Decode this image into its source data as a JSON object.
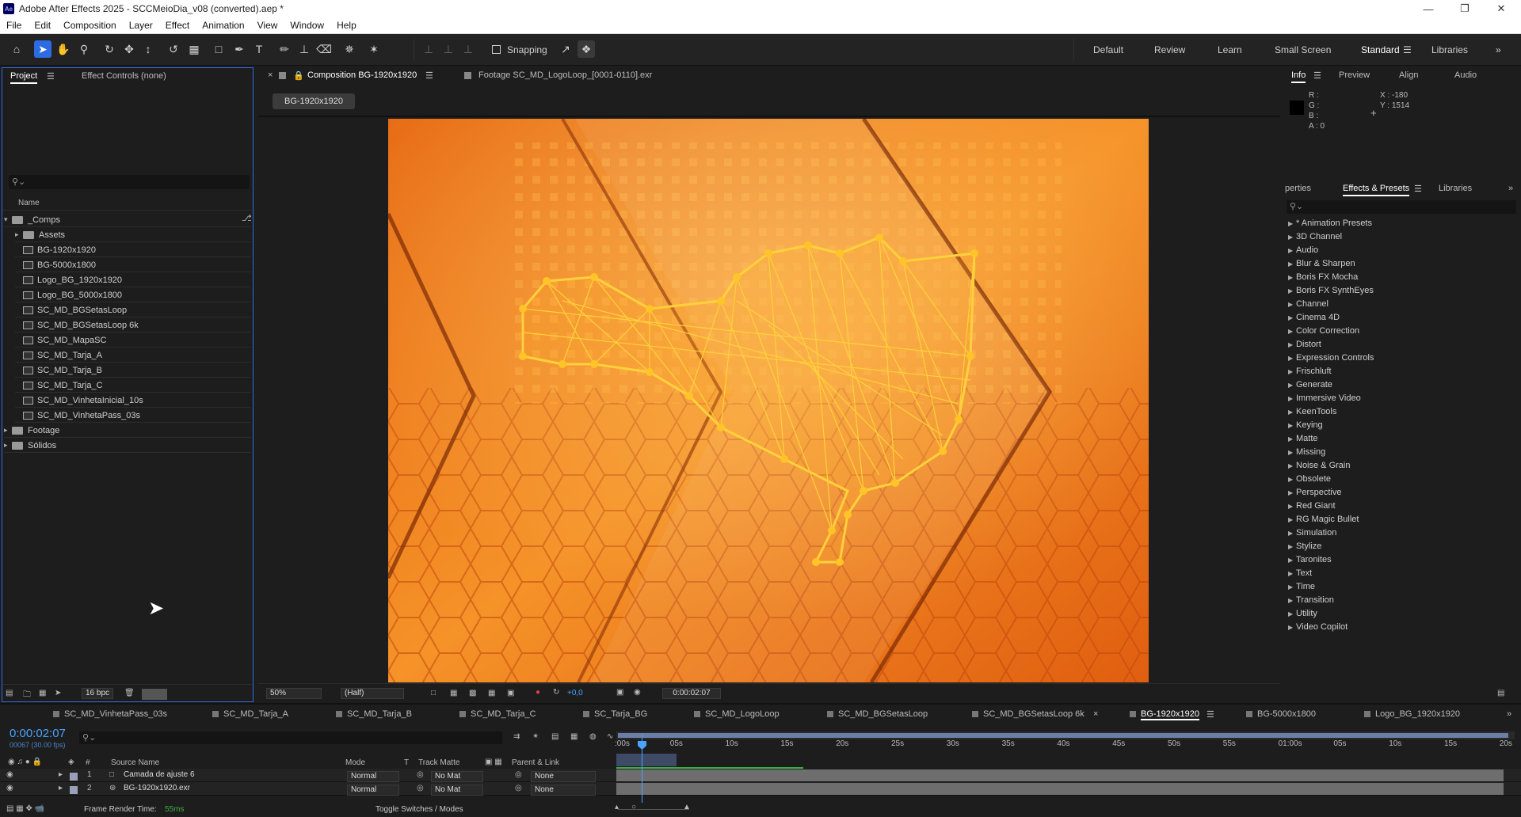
{
  "app": {
    "title": "Adobe After Effects 2025 - SCCMeioDia_v08 (converted).aep *",
    "icon_text": "Ae"
  },
  "menu": [
    "File",
    "Edit",
    "Composition",
    "Layer",
    "Effect",
    "Animation",
    "View",
    "Window",
    "Help"
  ],
  "toolbar": {
    "snapping_label": "Snapping",
    "workspaces": [
      "Default",
      "Review",
      "Learn",
      "Small Screen",
      "Standard",
      "Libraries"
    ],
    "active_workspace": "Standard"
  },
  "project": {
    "tab_project": "Project",
    "tab_effect_controls": "Effect Controls (none)",
    "search_placeholder": "",
    "column_name": "Name",
    "items": [
      {
        "type": "folder",
        "label": "_Comps",
        "depth": 0,
        "open": true
      },
      {
        "type": "folder",
        "label": "Assets",
        "depth": 1,
        "open": false
      },
      {
        "type": "comp",
        "label": "BG-1920x1920",
        "depth": 1
      },
      {
        "type": "comp",
        "label": "BG-5000x1800",
        "depth": 1
      },
      {
        "type": "comp",
        "label": "Logo_BG_1920x1920",
        "depth": 1
      },
      {
        "type": "comp",
        "label": "Logo_BG_5000x1800",
        "depth": 1
      },
      {
        "type": "comp",
        "label": "SC_MD_BGSetasLoop",
        "depth": 1
      },
      {
        "type": "comp",
        "label": "SC_MD_BGSetasLoop 6k",
        "depth": 1
      },
      {
        "type": "comp",
        "label": "SC_MD_MapaSC",
        "depth": 1
      },
      {
        "type": "comp",
        "label": "SC_MD_Tarja_A",
        "depth": 1
      },
      {
        "type": "comp",
        "label": "SC_MD_Tarja_B",
        "depth": 1
      },
      {
        "type": "comp",
        "label": "SC_MD_Tarja_C",
        "depth": 1
      },
      {
        "type": "comp",
        "label": "SC_MD_VinhetaInicial_10s",
        "depth": 1
      },
      {
        "type": "comp",
        "label": "SC_MD_VinhetaPass_03s",
        "depth": 1
      },
      {
        "type": "folder",
        "label": "Footage",
        "depth": 0,
        "open": false
      },
      {
        "type": "folder",
        "label": "Sólidos",
        "depth": 0,
        "open": false
      }
    ],
    "bpc": "16 bpc"
  },
  "viewer": {
    "tab_comp": "Composition BG-1920x1920",
    "tab_footage": "Footage SC_MD_LogoLoop_[0001-0110].exr",
    "breadcrumb": "BG-1920x1920",
    "zoom": "50%",
    "resolution": "(Half)",
    "exposure": "+0,0",
    "timecode": "0:00:02:07"
  },
  "info": {
    "tabs": [
      "Info",
      "Preview",
      "Align",
      "Audio"
    ],
    "r": "R :",
    "g": "G :",
    "b": "B :",
    "a": "A : 0",
    "x": "X : -180",
    "y": "Y : 1514"
  },
  "effects": {
    "tabs": [
      "perties",
      "Effects & Presets",
      "Libraries"
    ],
    "items": [
      "* Animation Presets",
      "3D Channel",
      "Audio",
      "Blur & Sharpen",
      "Boris FX Mocha",
      "Boris FX SynthEyes",
      "Channel",
      "Cinema 4D",
      "Color Correction",
      "Distort",
      "Expression Controls",
      "Frischluft",
      "Generate",
      "Immersive Video",
      "KeenTools",
      "Keying",
      "Matte",
      "Missing",
      "Noise & Grain",
      "Obsolete",
      "Perspective",
      "Red Giant",
      "RG Magic Bullet",
      "Simulation",
      "Stylize",
      "Taronites",
      "Text",
      "Time",
      "Transition",
      "Utility",
      "Video Copilot"
    ]
  },
  "timeline": {
    "tabs": [
      "SC_MD_VinhetaPass_03s",
      "SC_MD_Tarja_A",
      "SC_MD_Tarja_B",
      "SC_MD_Tarja_C",
      "SC_Tarja_BG",
      "SC_MD_LogoLoop",
      "SC_MD_BGSetasLoop",
      "SC_MD_BGSetasLoop 6k",
      "BG-1920x1920",
      "BG-5000x1800",
      "Logo_BG_1920x1920"
    ],
    "active_tab": "BG-1920x1920",
    "timecode": "0:00:02:07",
    "frame_info": "00067 (30.00 fps)",
    "columns": {
      "hash": "#",
      "source": "Source Name",
      "mode": "Mode",
      "t": "T",
      "track_matte": "Track Matte",
      "parent": "Parent & Link"
    },
    "ruler": [
      ":00s",
      "05s",
      "10s",
      "15s",
      "20s",
      "25s",
      "30s",
      "35s",
      "40s",
      "45s",
      "50s",
      "55s",
      "01:00s",
      "05s",
      "10s",
      "15s",
      "20s"
    ],
    "layers": [
      {
        "num": "1",
        "name": "Camada de ajuste 6",
        "mode": "Normal",
        "matte": "No Mat",
        "parent": "None"
      },
      {
        "num": "2",
        "name": "BG-1920x1920.exr",
        "mode": "Normal",
        "matte": "No Mat",
        "parent": "None"
      }
    ],
    "frame_render_label": "Frame Render Time:",
    "frame_render_value": "55ms",
    "toggle_label": "Toggle Switches / Modes"
  },
  "colors": {
    "accent": "#2d6be2",
    "timecode": "#4aa3ff",
    "orange": "#f08a1e"
  }
}
